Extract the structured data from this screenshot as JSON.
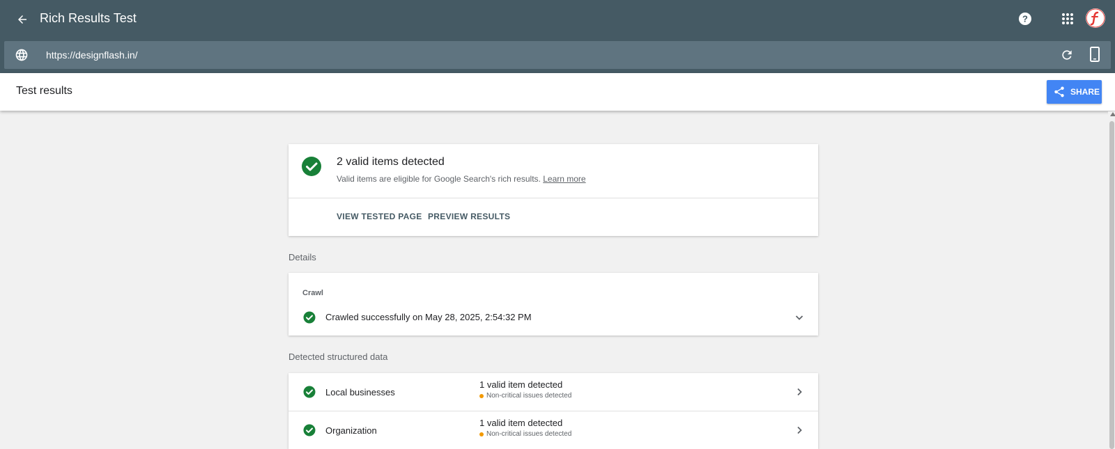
{
  "app": {
    "title": "Rich Results Test"
  },
  "url_bar": {
    "value": "https://designflash.in/"
  },
  "subheader": {
    "title": "Test results",
    "share_label": "SHARE"
  },
  "summary": {
    "title": "2 valid items detected",
    "subtitle": "Valid items are eligible for Google Search's rich results.",
    "learn_more": "Learn more",
    "actions": [
      "VIEW TESTED PAGE",
      "PREVIEW RESULTS"
    ]
  },
  "details": {
    "label": "Details",
    "crawl_label": "Crawl",
    "crawl_status": "Crawled successfully on May 28, 2025, 2:54:32 PM"
  },
  "structured": {
    "label": "Detected structured data",
    "items": [
      {
        "name": "Local businesses",
        "valid": "1 valid item detected",
        "issues": "Non-critical issues detected"
      },
      {
        "name": "Organization",
        "valid": "1 valid item detected",
        "issues": "Non-critical issues detected"
      }
    ]
  },
  "colors": {
    "appbar": "#455a64",
    "urlbar": "#5f7480",
    "accent": "#4285f4",
    "success": "#188038",
    "warning": "#f29900"
  },
  "icons": [
    "back-arrow-icon",
    "help-icon",
    "apps-grid-icon",
    "avatar-logo",
    "globe-icon",
    "reload-icon",
    "smartphone-icon",
    "share-icon",
    "check-circle-icon",
    "chevron-down-icon",
    "chevron-right-icon"
  ]
}
